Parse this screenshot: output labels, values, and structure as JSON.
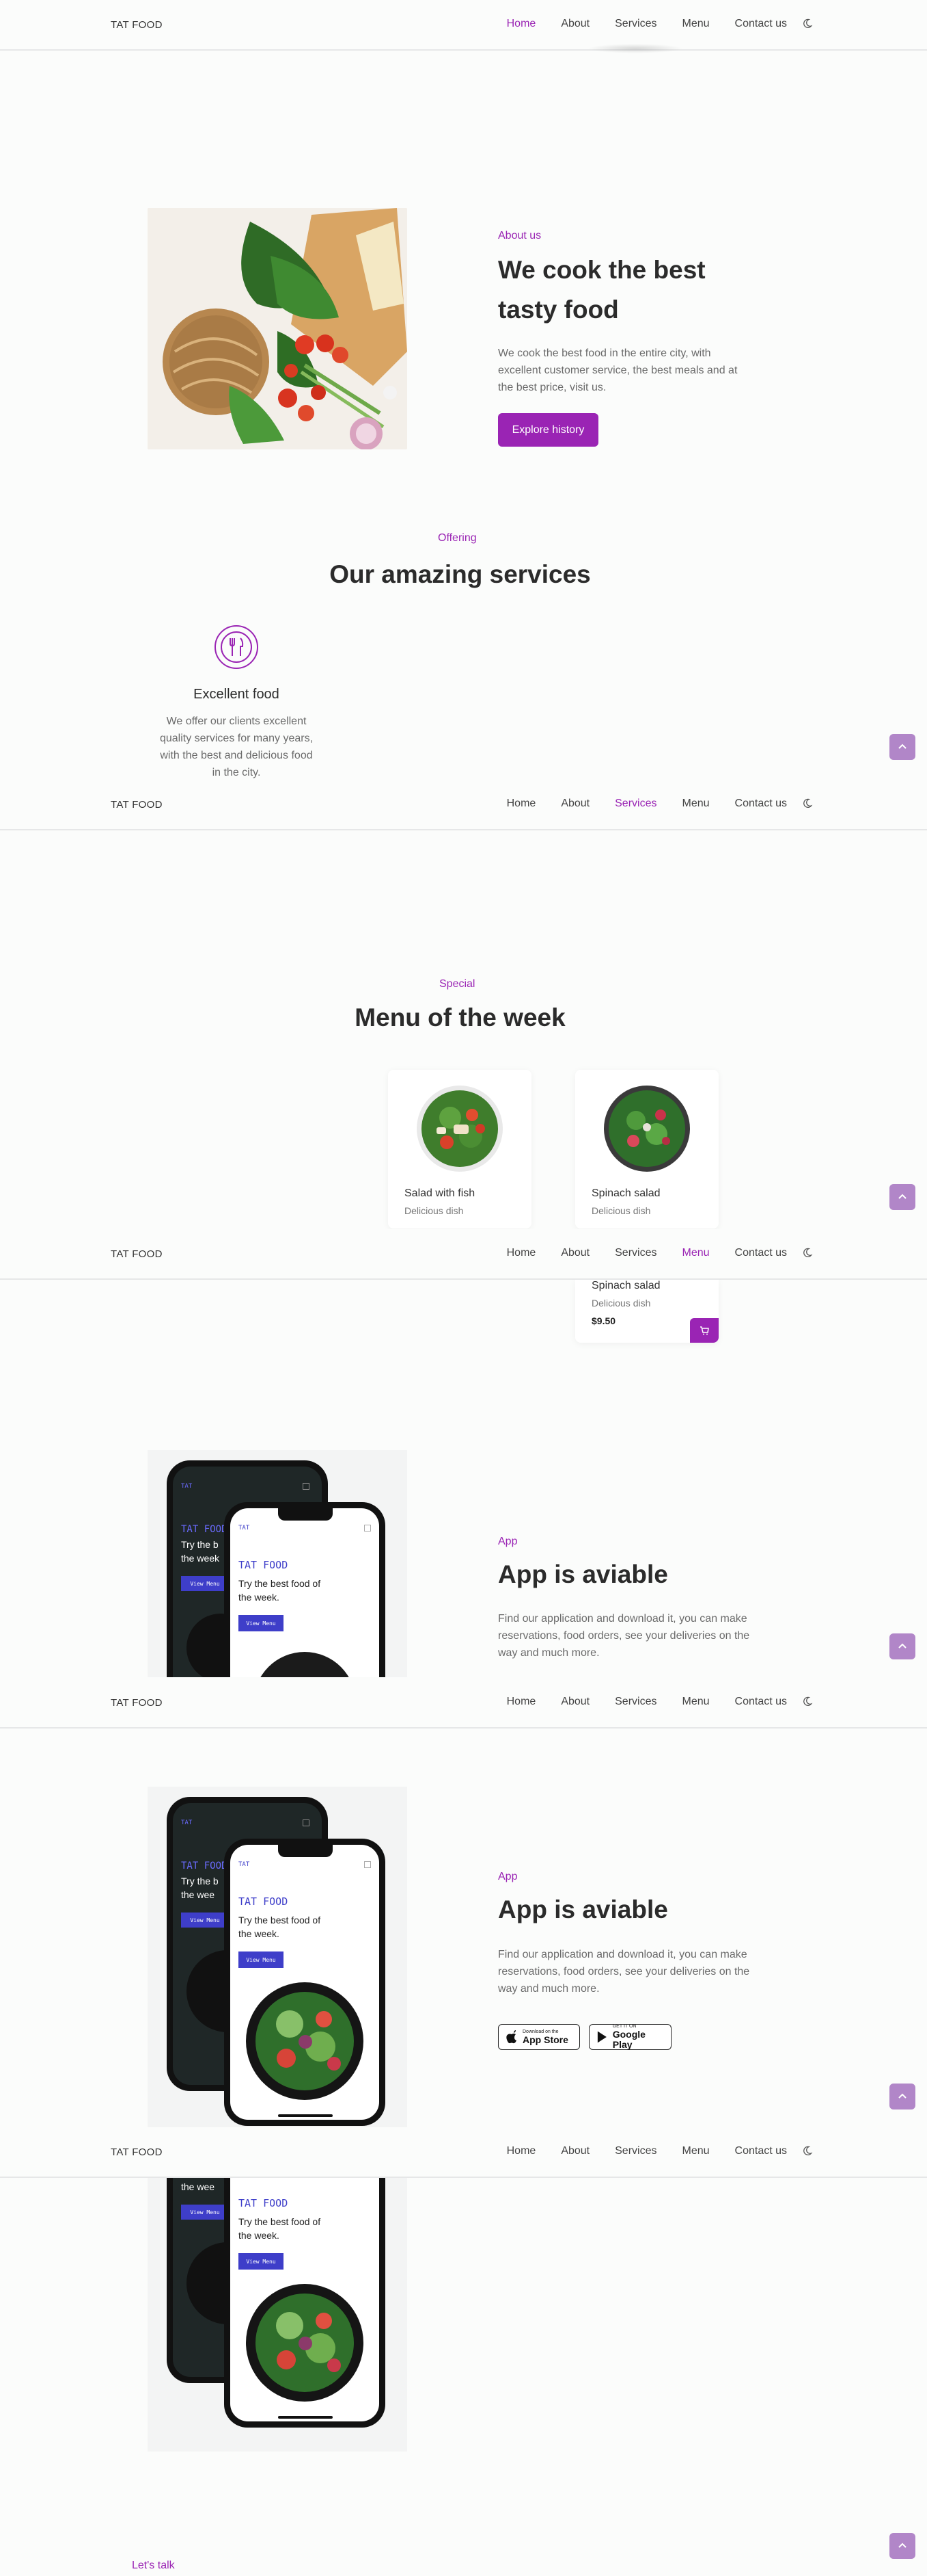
{
  "nav": {
    "logo": "TAT FOOD",
    "items": [
      "Home",
      "About",
      "Services",
      "Menu",
      "Contact us"
    ]
  },
  "about": {
    "subtitle": "About us",
    "title_line1": "We cook the best",
    "title_line2": "tasty food",
    "para_line1": "We cook the best food in the entire city, with",
    "para_line2": "excellent customer service, the best meals and at",
    "para_line3": "the best price, visit us.",
    "button": "Explore history"
  },
  "services": {
    "subtitle": "Offering",
    "title": "Our amazing services",
    "item_title": "Excellent food",
    "item_line1": "We offer our clients excellent",
    "item_line2": "quality services for many years,",
    "item_line3": "with the best and delicious food",
    "item_line4": "in the city."
  },
  "menu": {
    "subtitle": "Special",
    "title": "Menu of the week",
    "dishes": [
      {
        "name": "Salad with fish",
        "desc": "Delicious dish"
      },
      {
        "name": "Spinach salad",
        "desc": "Delicious dish",
        "price": "$9.50"
      }
    ]
  },
  "app": {
    "subtitle": "App",
    "title": "App is aviable",
    "para_line1": "Find our application and download it, you can make",
    "para_line2": "reservations, food orders, see your deliveries on the",
    "para_line3": "way and much more.",
    "appstore_small": "Download on the",
    "appstore_big": "App Store",
    "googleplay_small": "GET IT ON",
    "googleplay_big": "Google Play"
  },
  "mockup": {
    "brand": "TAT",
    "title": "TAT FOOD",
    "text_line1": "Try the best food of",
    "text_line2": "the week.",
    "back_text_line1": "Try the b",
    "back_text_line2": "the week",
    "back_text_line2_short": "the wee",
    "button": "View Menu",
    "button_short": "View Menu"
  },
  "contact": {
    "subtitle": "Let's talk"
  },
  "colors": {
    "accent": "#9a24b4",
    "scroll_button": "#b186c8",
    "background": "#fbfcfb",
    "mock_button": "#3e3ec9"
  }
}
